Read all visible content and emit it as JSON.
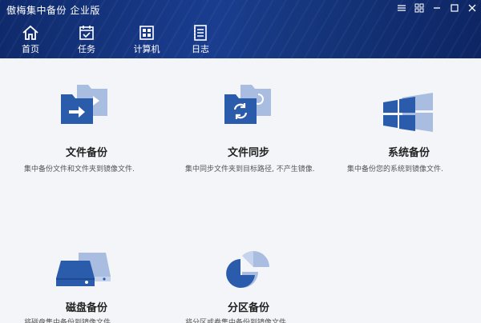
{
  "window": {
    "title": "傲梅集中备份 企业版",
    "controls": [
      "menu",
      "restore",
      "minimize",
      "maximize",
      "close"
    ]
  },
  "nav": [
    {
      "label": "首页",
      "icon": "home-icon"
    },
    {
      "label": "任务",
      "icon": "task-icon"
    },
    {
      "label": "计算机",
      "icon": "computer-icon"
    },
    {
      "label": "日志",
      "icon": "log-icon"
    }
  ],
  "tiles": [
    {
      "title": "文件备份",
      "desc": "集中备份文件和文件夹到镜像文件.",
      "icon": "file-backup-icon"
    },
    {
      "title": "文件同步",
      "desc": "集中同步文件夹到目标路径, 不产生镜像.",
      "icon": "file-sync-icon"
    },
    {
      "title": "系统备份",
      "desc": "集中备份您的系统到镜像文件.",
      "icon": "system-backup-icon"
    },
    {
      "title": "磁盘备份",
      "desc": "将磁盘集中备份到镜像文件",
      "icon": "disk-backup-icon"
    },
    {
      "title": "分区备份",
      "desc": "将分区或卷集中备份到镜像文件",
      "icon": "partition-backup-icon"
    }
  ],
  "colors": {
    "header": "#16377f",
    "icon_dark": "#2b5cab",
    "icon_light": "#a9bde0",
    "background": "#f4f5f9"
  }
}
